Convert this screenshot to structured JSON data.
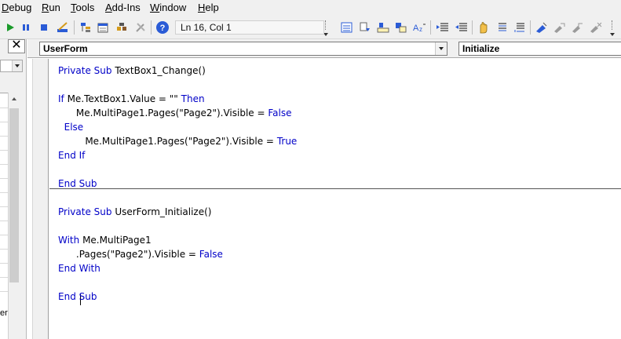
{
  "menu": {
    "items": [
      {
        "label": "Debug",
        "accel_index": 0
      },
      {
        "label": "Run",
        "accel_index": 0
      },
      {
        "label": "Tools",
        "accel_index": 0
      },
      {
        "label": "Add-Ins",
        "accel_index": 0
      },
      {
        "label": "Window",
        "accel_index": 0
      },
      {
        "label": "Help",
        "accel_index": 0
      }
    ]
  },
  "toolbar": {
    "position_status": "Ln 16, Col 1",
    "icons": [
      "run-icon",
      "break-icon",
      "reset-icon",
      "design-mode-icon",
      "project-explorer-icon",
      "properties-window-icon",
      "object-browser-icon",
      "toolbox-icon",
      "help-icon",
      "list-properties-icon",
      "list-constants-icon",
      "quick-info-icon",
      "parameter-info-icon",
      "complete-word-icon",
      "indent-icon",
      "outdent-icon",
      "toggle-breakpoint-icon",
      "comment-block-icon",
      "uncomment-block-icon",
      "toggle-bookmark-icon",
      "next-bookmark-icon",
      "previous-bookmark-icon",
      "clear-bookmarks-icon"
    ]
  },
  "left_pane": {
    "close_glyph": "✕",
    "fragment_text": "er"
  },
  "code_window": {
    "object_combo": "UserForm",
    "procedure_combo": "Initialize",
    "lines": [
      [
        {
          "t": "Private Sub ",
          "kw": true
        },
        {
          "t": "TextBox1_Change()",
          "kw": false
        }
      ],
      [],
      [
        {
          "t": "If ",
          "kw": true
        },
        {
          "t": "Me.TextBox1.Value = \"\" ",
          "kw": false
        },
        {
          "t": "Then",
          "kw": true
        }
      ],
      [
        {
          "t": "      Me.MultiPage1.Pages(\"Page2\").Visible = ",
          "kw": false
        },
        {
          "t": "False",
          "kw": true
        }
      ],
      [
        {
          "t": "  Else",
          "kw": true
        }
      ],
      [
        {
          "t": "         Me.MultiPage1.Pages(\"Page2\").Visible = ",
          "kw": false
        },
        {
          "t": "True",
          "kw": true
        }
      ],
      [
        {
          "t": "End If",
          "kw": true
        }
      ],
      [],
      [
        {
          "t": "End Sub",
          "kw": true
        }
      ],
      [],
      [
        {
          "t": "Private Sub ",
          "kw": true
        },
        {
          "t": "UserForm_Initialize()",
          "kw": false
        }
      ],
      [],
      [
        {
          "t": "With ",
          "kw": true
        },
        {
          "t": "Me.MultiPage1",
          "kw": false
        }
      ],
      [
        {
          "t": "      .Pages(\"Page2\").Visible = ",
          "kw": false
        },
        {
          "t": "False",
          "kw": true
        }
      ],
      [
        {
          "t": "End With",
          "kw": true
        }
      ],
      [],
      [
        {
          "t": "End Sub",
          "kw": true
        }
      ]
    ]
  },
  "colors": {
    "keyword": "#0000c8",
    "chrome": "#f0f0f0"
  }
}
